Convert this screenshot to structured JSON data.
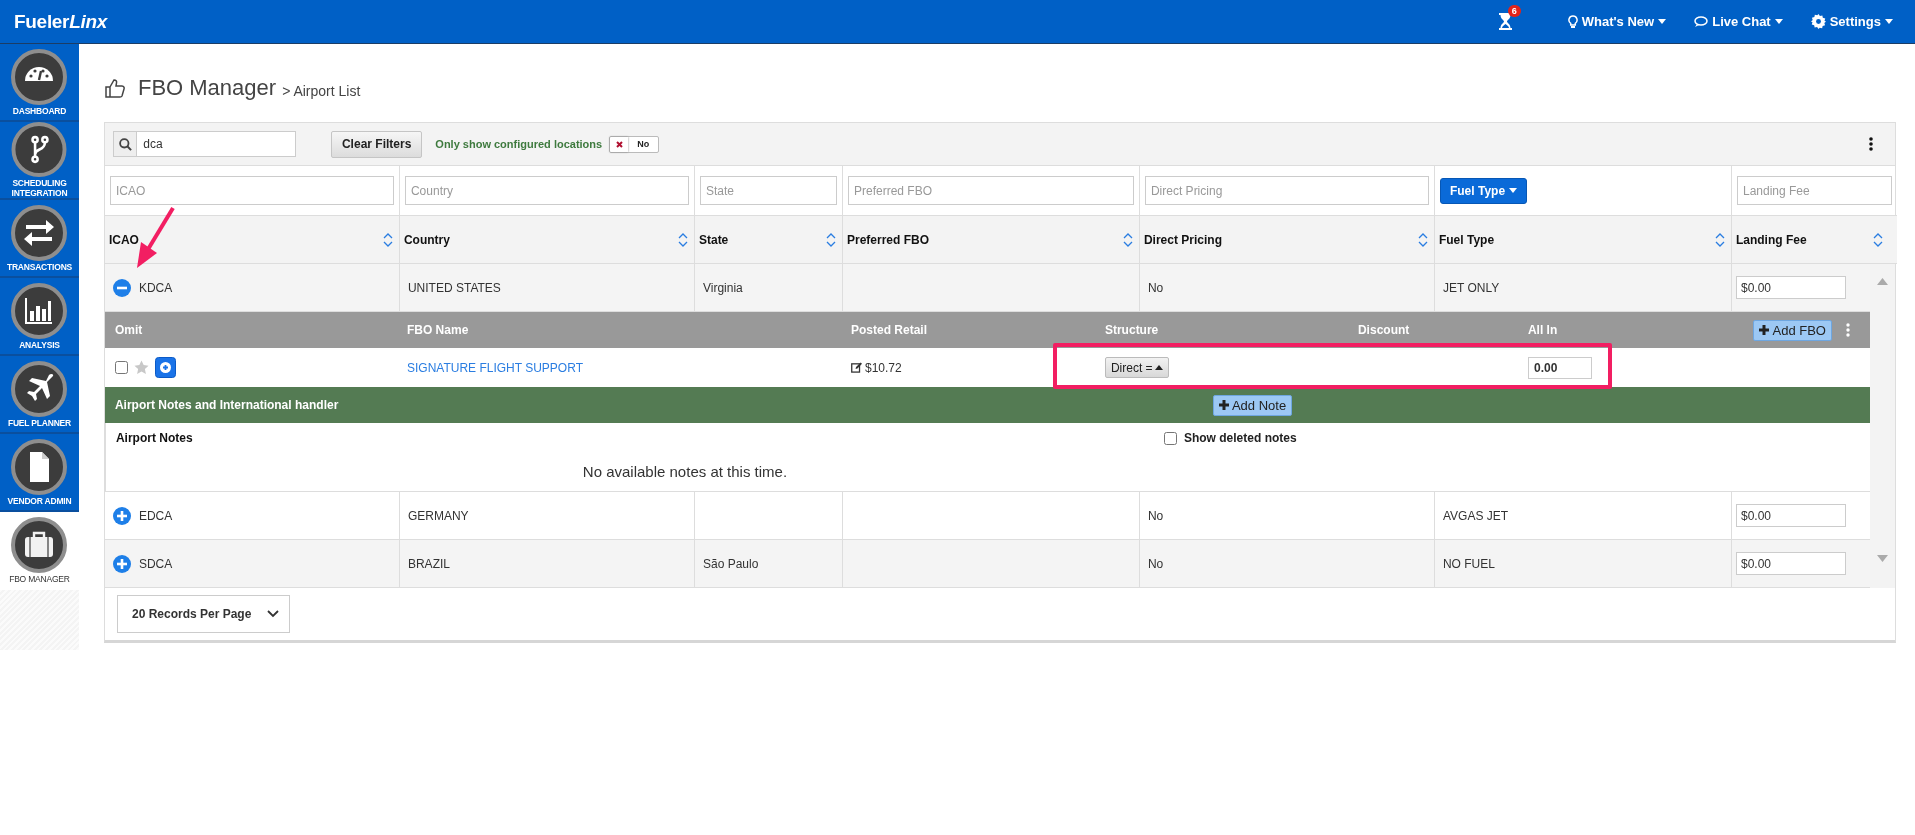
{
  "topbar": {
    "logo": [
      {
        "text": "Fueler",
        "italic": false
      },
      {
        "text": "Linx",
        "italic": true
      }
    ],
    "notifications": "6",
    "menus": [
      {
        "kind": "whats-new",
        "label": "What's New"
      },
      {
        "kind": "chat",
        "label": "Live Chat"
      },
      {
        "kind": "settings",
        "label": "Settings"
      }
    ]
  },
  "sidebar": {
    "items": [
      {
        "kind": "dashboard",
        "label": "DASHBOARD",
        "selected": false
      },
      {
        "kind": "scheduling",
        "label": "SCHEDULING INTEGRATION",
        "selected": false
      },
      {
        "kind": "transactions",
        "label": "TRANSACTIONS",
        "selected": false
      },
      {
        "kind": "analysis",
        "label": "ANALYSIS",
        "selected": false
      },
      {
        "kind": "fuel-planner",
        "label": "FUEL PLANNER",
        "selected": false
      },
      {
        "kind": "vendor-admin",
        "label": "VENDOR ADMIN",
        "selected": false
      },
      {
        "kind": "fbo-manager",
        "label": "FBO MANAGER",
        "selected": true
      }
    ]
  },
  "page": {
    "title": "FBO Manager",
    "breadcrumb": "> Airport List"
  },
  "toolbar": {
    "search": "dca",
    "clear_button": "Clear Filters",
    "configured_label": "Only show configured locations",
    "configured_toggle": {
      "on": false,
      "label": "No"
    }
  },
  "filters": [
    {
      "kind": "field",
      "placeholder": "ICAO"
    },
    {
      "kind": "field",
      "placeholder": "Country"
    },
    {
      "kind": "field",
      "placeholder": "State"
    },
    {
      "kind": "field",
      "placeholder": "Preferred FBO"
    },
    {
      "kind": "field",
      "placeholder": "Direct Pricing"
    },
    {
      "kind": "dropdown",
      "label": "Fuel Type"
    },
    {
      "kind": "field",
      "placeholder": "Landing Fee"
    }
  ],
  "columns": [
    "ICAO",
    "Country",
    "State",
    "Preferred FBO",
    "Direct Pricing",
    "Fuel Type",
    "Landing Fee"
  ],
  "rows": [
    {
      "expanded": true,
      "cells": [
        "KDCA",
        "UNITED STATES",
        "Virginia",
        null,
        "No",
        "JET ONLY"
      ],
      "landing_fee": "$0.00",
      "details": {
        "columns": [
          "Omit",
          "FBO Name",
          "Posted Retail",
          "Structure",
          "Discount",
          "All In"
        ],
        "add_fbo": "Add FBO",
        "fbos": [
          {
            "omit": false,
            "favorite": false,
            "name": "SIGNATURE FLIGHT SUPPORT",
            "posted_retail": "$10.72",
            "structure": "Direct =",
            "all_in": "0.00"
          }
        ],
        "notes": {
          "title": "Airport Notes and International handler",
          "add_button": "Add Note",
          "heading": "Airport Notes",
          "show_deleted_label": "Show deleted notes",
          "show_deleted": false,
          "empty_text": "No available notes at this time."
        }
      }
    },
    {
      "expanded": false,
      "cells": [
        "EDCA",
        "GERMANY",
        null,
        null,
        "No",
        "AVGAS JET"
      ],
      "landing_fee": "$0.00"
    },
    {
      "expanded": false,
      "cells": [
        "SDCA",
        "BRAZIL",
        "São Paulo",
        null,
        "No",
        "NO FUEL"
      ],
      "landing_fee": "$0.00"
    }
  ],
  "footer": {
    "per_page": "20 Records Per Page"
  }
}
